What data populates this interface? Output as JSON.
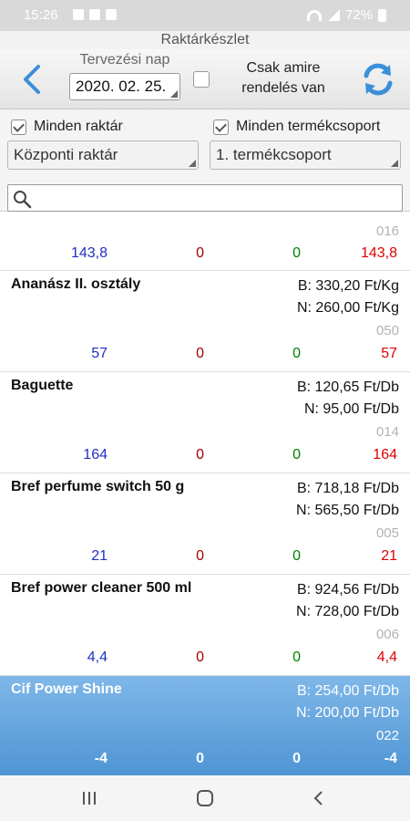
{
  "status": {
    "time": "15:26",
    "battery": "72%"
  },
  "title": "Raktárkészlet",
  "toolbar": {
    "date_label": "Tervezési nap",
    "date_value": "2020. 02. 25.",
    "only_label_line1": "Csak amire",
    "only_label_line2": "rendelés van"
  },
  "filters": {
    "all_warehouse_label": "Minden raktár",
    "all_group_label": "Minden termékcsoport",
    "warehouse_value": "Központi raktár",
    "group_value": "1. termékcsoport",
    "search_placeholder": ""
  },
  "items": [
    {
      "name": "",
      "buy": "",
      "net": "",
      "code": "016",
      "v1": "143,8",
      "v2": "0",
      "v3": "0",
      "v4": "143,8"
    },
    {
      "name": "Ananász II. osztály",
      "buy": "B: 330,20 Ft/Kg",
      "net": "N: 260,00 Ft/Kg",
      "code": "050",
      "v1": "57",
      "v2": "0",
      "v3": "0",
      "v4": "57"
    },
    {
      "name": "Baguette",
      "buy": "B: 120,65 Ft/Db",
      "net": "N: 95,00 Ft/Db",
      "code": "014",
      "v1": "164",
      "v2": "0",
      "v3": "0",
      "v4": "164"
    },
    {
      "name": "Bref perfume switch 50 g",
      "buy": "B: 718,18 Ft/Db",
      "net": "N: 565,50 Ft/Db",
      "code": "005",
      "v1": "21",
      "v2": "0",
      "v3": "0",
      "v4": "21"
    },
    {
      "name": "Bref power cleaner 500 ml",
      "buy": "B: 924,56 Ft/Db",
      "net": "N: 728,00 Ft/Db",
      "code": "006",
      "v1": "4,4",
      "v2": "0",
      "v3": "0",
      "v4": "4,4"
    },
    {
      "name": "Cif Power Shine",
      "buy": "B: 254,00 Ft/Db",
      "net": "N: 200,00 Ft/Db",
      "code": "022",
      "v1": "-4",
      "v2": "0",
      "v3": "0",
      "v4": "-4"
    }
  ],
  "colors": {
    "accent": "#3b8fd9",
    "selected_top": "#7fb7e8",
    "selected_bottom": "#4f95d4"
  }
}
